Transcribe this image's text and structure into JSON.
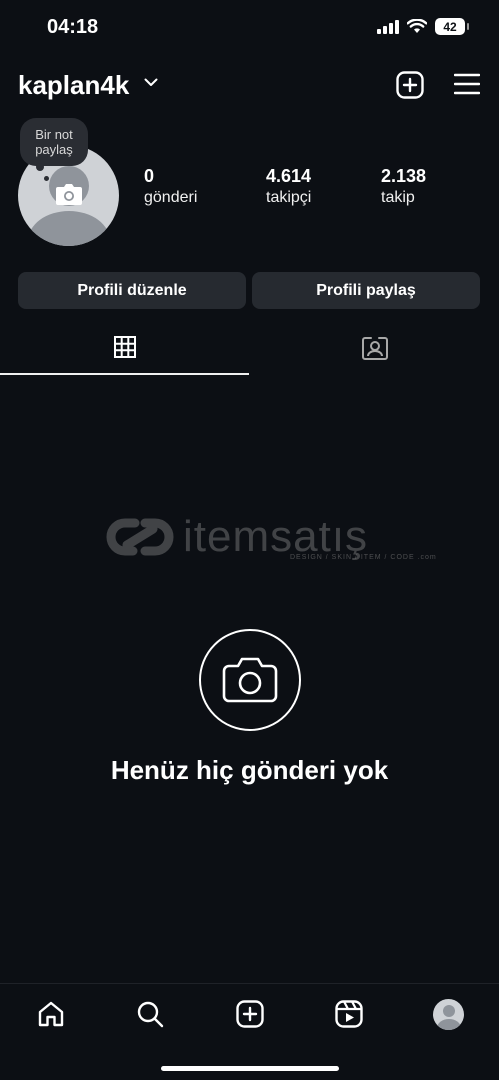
{
  "status_bar": {
    "time": "04:18",
    "battery": "42",
    "icons": [
      "signal-icon",
      "wifi-icon",
      "battery-icon"
    ]
  },
  "header": {
    "username": "kaplan4k",
    "icons": [
      "chevron-down-icon",
      "create-plus-icon",
      "menu-icon"
    ]
  },
  "profile": {
    "note": "Bir not paylaş",
    "stats": [
      {
        "value": "0",
        "label": "gönderi"
      },
      {
        "value": "4.614",
        "label": "takipçi"
      },
      {
        "value": "2.138",
        "label": "takip"
      }
    ]
  },
  "actions": {
    "edit_label": "Profili düzenle",
    "share_label": "Profili paylaş"
  },
  "tabs": [
    {
      "name": "grid",
      "icon": "grid-icon",
      "active": true
    },
    {
      "name": "tagged",
      "icon": "tagged-icon",
      "active": false
    }
  ],
  "watermark": {
    "text": "itemsatış",
    "sub": "DESIGN / SKIN / ITEM / CODE .com"
  },
  "empty_state": {
    "title": "Henüz hiç gönderi yok",
    "icon": "camera-icon"
  },
  "bottom_nav": [
    "home-icon",
    "search-icon",
    "create-icon",
    "reels-icon",
    "profile-avatar"
  ],
  "colors": {
    "background": "#0c0f14",
    "button": "#262a30",
    "text": "#ffffff"
  }
}
